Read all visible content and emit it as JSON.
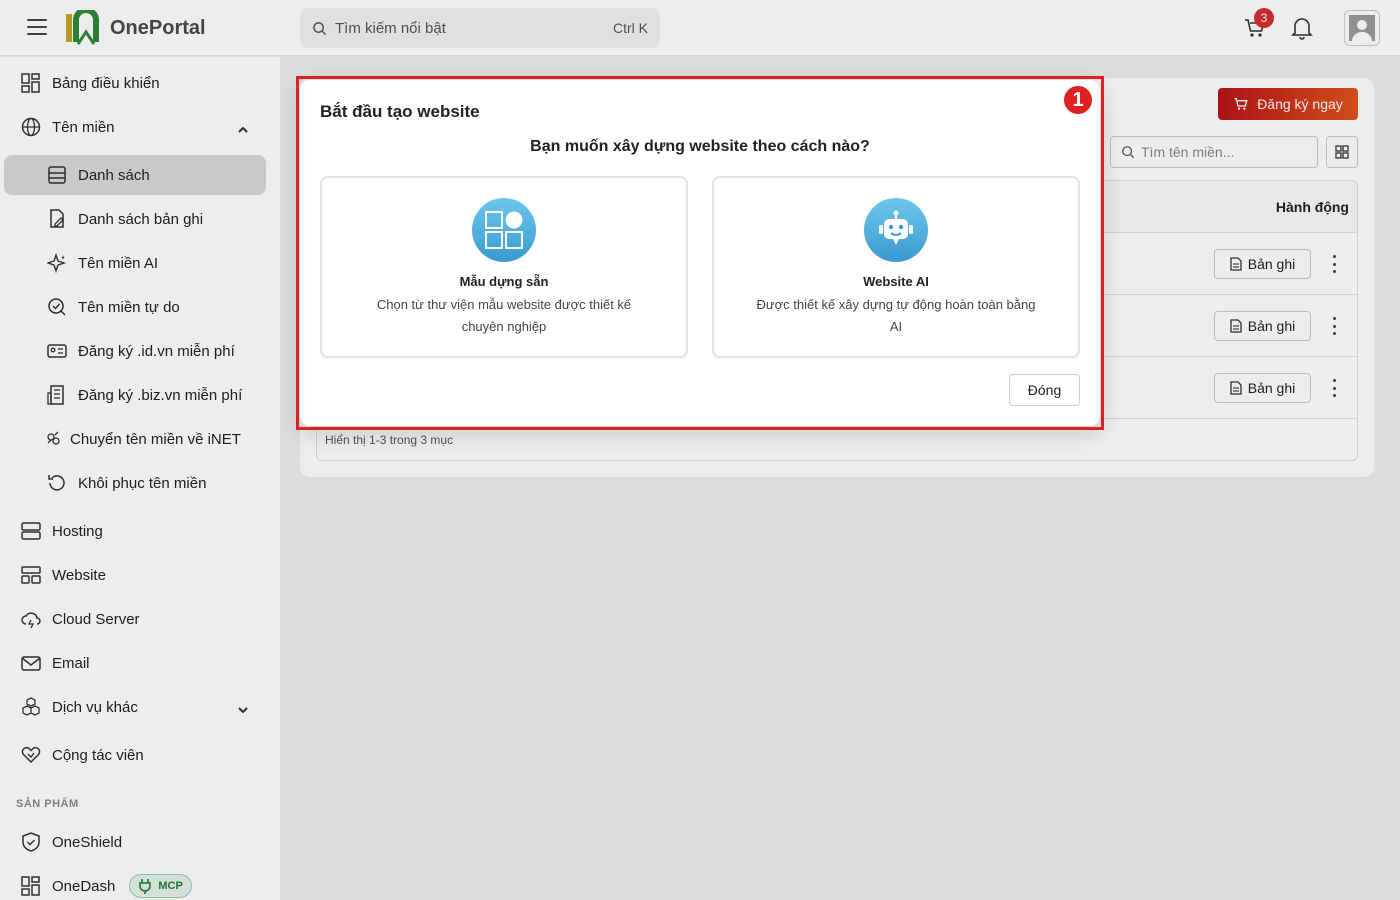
{
  "header": {
    "app_name": "OnePortal",
    "search_placeholder": "Tìm kiếm nổi bật",
    "search_shortcut": "Ctrl K",
    "cart_count": "3"
  },
  "sidebar": {
    "items": [
      {
        "label": "Bảng điều khiển",
        "icon": "dashboard-icon"
      },
      {
        "label": "Tên miền",
        "icon": "globe-icon"
      },
      {
        "label": "Danh sách",
        "icon": "list-icon"
      },
      {
        "label": "Danh sách bản ghi",
        "icon": "file-edit-icon"
      },
      {
        "label": "Tên miền AI",
        "icon": "sparkle-icon"
      },
      {
        "label": "Tên miền tự do",
        "icon": "search-check-icon"
      },
      {
        "label": "Đăng ký .id.vn miễn phí",
        "icon": "id-card-icon"
      },
      {
        "label": "Đăng ký .biz.vn miễn phí",
        "icon": "building-icon"
      },
      {
        "label": "Chuyển tên miền về iNET",
        "icon": "transfer-icon"
      },
      {
        "label": "Khôi phục tên miền",
        "icon": "restore-icon"
      },
      {
        "label": "Hosting",
        "icon": "server-icon"
      },
      {
        "label": "Website",
        "icon": "layout-icon"
      },
      {
        "label": "Cloud Server",
        "icon": "cloud-icon"
      },
      {
        "label": "Email",
        "icon": "mail-icon"
      },
      {
        "label": "Dịch vụ khác",
        "icon": "boxes-icon"
      },
      {
        "label": "Cộng tác viên",
        "icon": "handshake-icon"
      }
    ],
    "section_products": "SẢN PHẨM",
    "products": [
      {
        "label": "OneShield",
        "icon": "shield-icon"
      },
      {
        "label": "OneDash",
        "icon": "dashboard-icon",
        "badge": "MCP"
      }
    ]
  },
  "main": {
    "register_button": "Đăng ký ngay",
    "domain_search_placeholder": "Tìm tên miền...",
    "table": {
      "action_header": "Hành động",
      "rows": [
        {
          "record_button": "Bản ghi"
        },
        {
          "record_button": "Bản ghi"
        },
        {
          "record_button": "Bản ghi"
        }
      ],
      "footer": "Hiển thị 1-3 trong 3 mục"
    }
  },
  "modal": {
    "title": "Bắt đầu tạo website",
    "question": "Bạn muốn xây dựng website theo cách nào?",
    "step_number": "1",
    "options": [
      {
        "title": "Mẫu dựng sẵn",
        "description": "Chọn từ thư viện mẫu website được thiết kế chuyên nghiệp",
        "icon": "template-grid-icon"
      },
      {
        "title": "Website AI",
        "description": "Được thiết kế xây dựng tự động hoàn toàn bằng AI",
        "icon": "robot-icon"
      }
    ],
    "close_button": "Đóng"
  }
}
